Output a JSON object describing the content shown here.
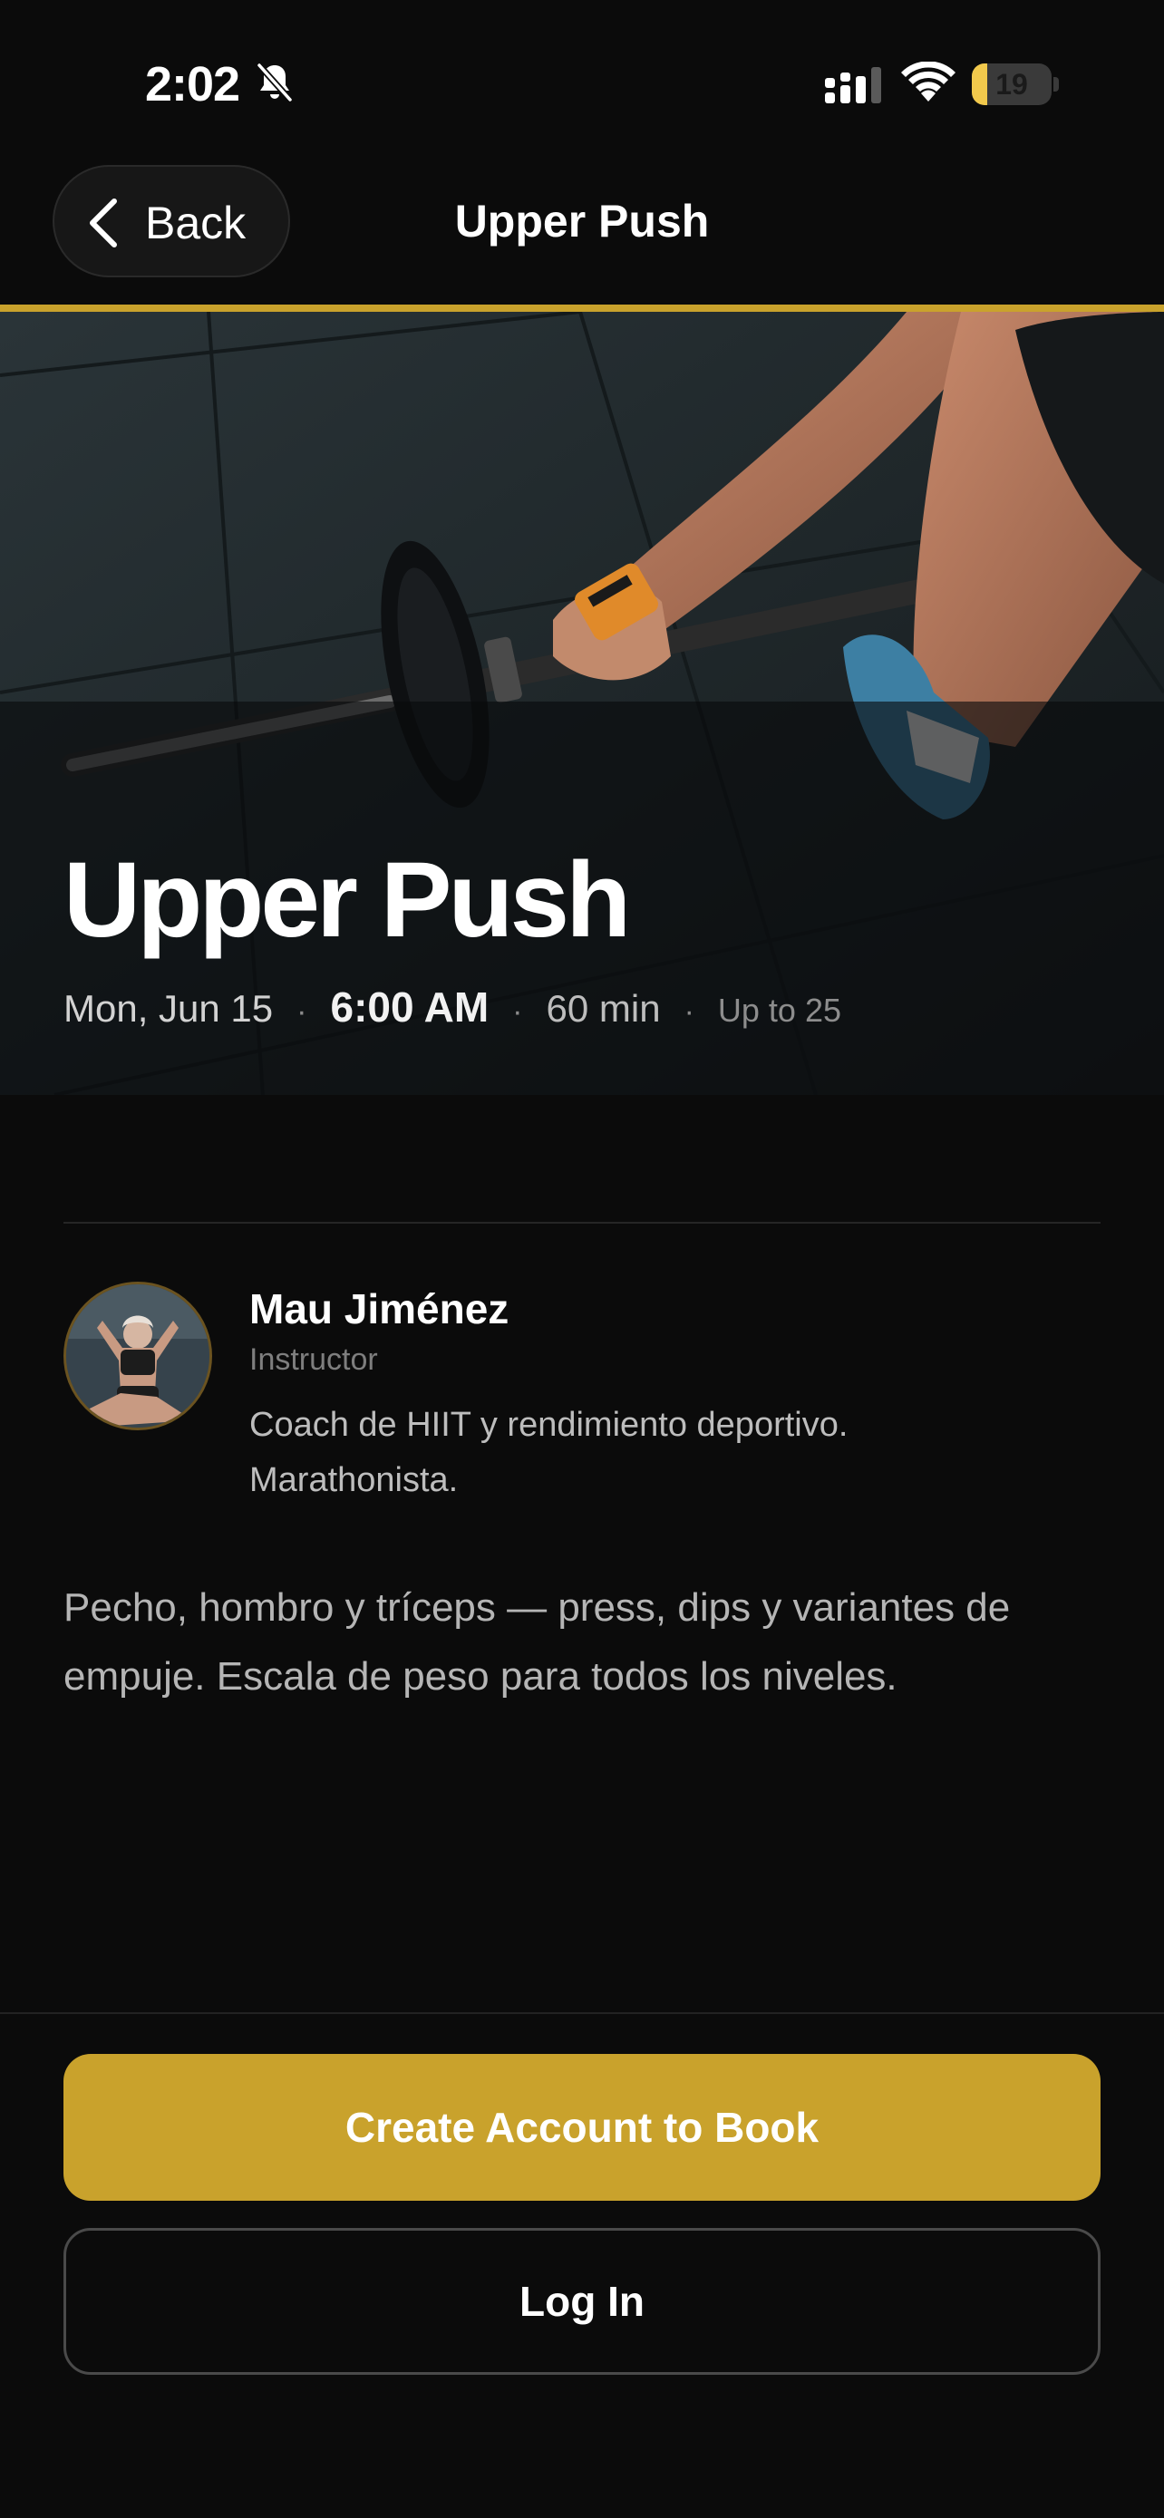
{
  "status_bar": {
    "time": "2:02",
    "battery_level": "19",
    "battery_fraction": 0.19,
    "icons": [
      "bell-slash-icon",
      "signal-icon",
      "wifi-icon",
      "battery-icon"
    ]
  },
  "nav": {
    "back_label": "Back",
    "title": "Upper Push"
  },
  "hero": {
    "title": "Upper Push",
    "date": "Mon, Jun 15",
    "separator": "·",
    "time": "6:00 AM",
    "duration": "60 min",
    "capacity": "Up to 25"
  },
  "instructor": {
    "name": "Mau Jiménez",
    "role": "Instructor",
    "bio": "Coach de HIIT y rendimiento deportivo. Marathonista."
  },
  "description": "Pecho, hombro y tríceps — press, dips y variantes de empuje. Escala de peso para todos los niveles.",
  "actions": {
    "primary": "Create Account to Book",
    "secondary": "Log In"
  },
  "colors": {
    "accent": "#c9a22c",
    "background": "#0b0b0b",
    "battery": "#f2c94c"
  }
}
